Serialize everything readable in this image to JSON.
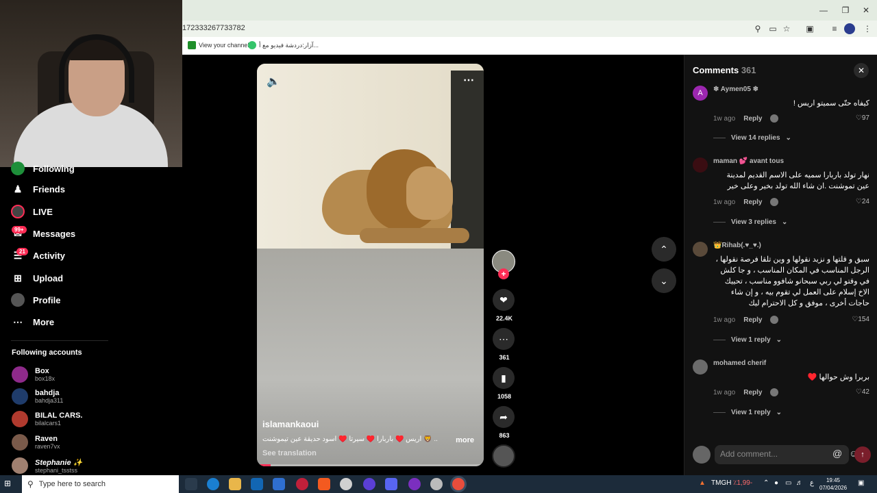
{
  "browser": {
    "url": "172333267733782",
    "bookmarks": [
      {
        "label": "View your channel"
      },
      {
        "label": "آزار:دردشة فيديو مع أ..."
      }
    ]
  },
  "sidebar": {
    "nav": [
      {
        "label": "Following",
        "icon": "following-icon"
      },
      {
        "label": "Friends",
        "icon": "friends-icon"
      },
      {
        "label": "LIVE",
        "icon": "live-icon"
      },
      {
        "label": "Messages",
        "icon": "messages-icon",
        "badge": "99+"
      },
      {
        "label": "Activity",
        "icon": "activity-icon",
        "badge": "21"
      },
      {
        "label": "Upload",
        "icon": "upload-icon"
      },
      {
        "label": "Profile",
        "icon": "profile-icon"
      },
      {
        "label": "More",
        "icon": "more-icon"
      }
    ],
    "following_title": "Following accounts",
    "accounts": [
      {
        "name": "Box",
        "handle": "box18x"
      },
      {
        "name": "bahdja",
        "handle": "bahdja311"
      },
      {
        "name": "BILAL CARS.",
        "handle": "bilalcars1"
      },
      {
        "name": "Raven",
        "handle": "raven7vx"
      },
      {
        "name": "Stephanie ✨",
        "handle": "stephani_tsstss"
      }
    ]
  },
  "video": {
    "author": "islamankaoui",
    "caption": "أريس ♥️ باربارا ♥️ سيرتا ♥️ اسود حديقة عين تيموشنت 🦁 ...",
    "more": "more",
    "see_translation": "See translation",
    "progress": 0.06
  },
  "actions": {
    "likes": "22.4K",
    "comments": "361",
    "saves": "1058",
    "shares": "863"
  },
  "comments": {
    "title": "Comments",
    "count": "361",
    "items": [
      {
        "avatar": "A",
        "avatar_color": "#9c27b0",
        "name": "❄ Aymen05 ❄",
        "text": "كيفاه حتّى سميتو اريس !",
        "time": "1w ago",
        "reply": "Reply",
        "likes": "97",
        "replies": "View 14 replies"
      },
      {
        "avatar": "",
        "avatar_color": "#3a0d12",
        "name": "maman 💕 avant tous",
        "text": "نهار تولد باربارا سميه على الاسم القديم لمدينة عين تموشنت .ان شاء الله تولد بخير وعلى خير",
        "time": "1w ago",
        "reply": "Reply",
        "likes": "24",
        "replies": "View 3 replies"
      },
      {
        "avatar": "",
        "avatar_color": "#5a4a3a",
        "name": "👑Rihab(.♥_♥.)",
        "text": "سبق و قلتها و نزيد نقولها و وين تلقا فرصة نقولها ، الرجل المناسب في المكان المناسب ، و جا كلش في وقتو لي ربي سبحانو شافوو مناسب ، تحييك الاخ إسلام على العمل لي تقوم بيه ، و إن شاء حاجات أخرى ، موفق و كل الاحترام ليك",
        "time": "1w ago",
        "reply": "Reply",
        "likes": "154",
        "replies": "View 1 reply"
      },
      {
        "avatar": "",
        "avatar_color": "#6b6b6b",
        "name": "mohamed cherif",
        "text": "بربرا وش حوالها ♥️",
        "time": "1w ago",
        "reply": "Reply",
        "likes": "42",
        "replies": "View 1 reply"
      }
    ],
    "input_placeholder": "Add comment..."
  },
  "taskbar": {
    "search_placeholder": "Type here to search",
    "tray_stock": "TMGH",
    "tray_change": "٪1,99-",
    "lang": "ع",
    "time": "19:45",
    "date": "07/04/2026"
  }
}
